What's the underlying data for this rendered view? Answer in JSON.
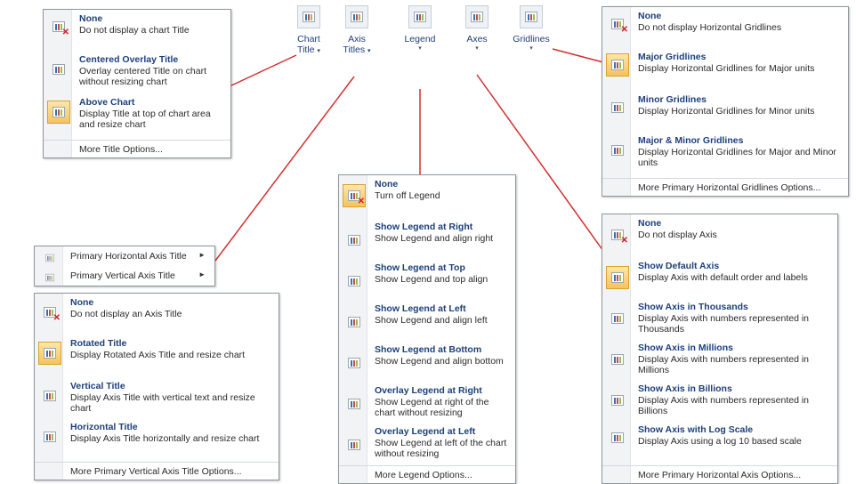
{
  "ribbon": {
    "chart_title": {
      "line1": "Chart",
      "line2": "Title"
    },
    "axis_titles": {
      "line1": "Axis",
      "line2": "Titles"
    },
    "legend": "Legend",
    "axes": "Axes",
    "gridlines": "Gridlines",
    "dropdown": "▾"
  },
  "chart_title_menu": {
    "items": [
      {
        "title": "None",
        "desc": "Do not display a chart Title"
      },
      {
        "title": "Centered Overlay Title",
        "desc": "Overlay centered Title on chart without resizing chart"
      },
      {
        "title": "Above Chart",
        "desc": "Display Title at top of chart area and resize chart"
      }
    ],
    "more": "More Title Options..."
  },
  "gridlines_menu": {
    "items": [
      {
        "title": "None",
        "desc": "Do not display Horizontal Gridlines"
      },
      {
        "title": "Major Gridlines",
        "desc": "Display Horizontal Gridlines for Major units"
      },
      {
        "title": "Minor Gridlines",
        "desc": "Display Horizontal Gridlines for Minor units"
      },
      {
        "title": "Major & Minor Gridlines",
        "desc": "Display Horizontal Gridlines for Major and Minor units"
      }
    ],
    "more": "More Primary Horizontal Gridlines Options..."
  },
  "axis_titles_submenu": {
    "items": [
      "Primary Horizontal Axis Title",
      "Primary Vertical Axis Title"
    ]
  },
  "vertical_axis_title_menu": {
    "items": [
      {
        "title": "None",
        "desc": "Do not display an Axis Title"
      },
      {
        "title": "Rotated Title",
        "desc": "Display Rotated Axis Title and resize chart"
      },
      {
        "title": "Vertical Title",
        "desc": "Display Axis Title with vertical text and resize chart"
      },
      {
        "title": "Horizontal Title",
        "desc": "Display Axis Title horizontally and resize chart"
      }
    ],
    "more": "More Primary Vertical Axis Title Options..."
  },
  "legend_menu": {
    "items": [
      {
        "title": "None",
        "desc": "Turn off Legend"
      },
      {
        "title": "Show Legend at Right",
        "desc": "Show Legend and align right"
      },
      {
        "title": "Show Legend at Top",
        "desc": "Show Legend and top align"
      },
      {
        "title": "Show Legend at Left",
        "desc": "Show Legend and align left"
      },
      {
        "title": "Show Legend at Bottom",
        "desc": "Show Legend and align bottom"
      },
      {
        "title": "Overlay Legend at Right",
        "desc": "Show Legend at right of the chart without resizing"
      },
      {
        "title": "Overlay Legend at Left",
        "desc": "Show Legend at left of the chart without resizing"
      }
    ],
    "more": "More Legend Options..."
  },
  "axes_menu": {
    "items": [
      {
        "title": "None",
        "desc": "Do not display Axis"
      },
      {
        "title": "Show Default Axis",
        "desc": "Display Axis with default order and labels"
      },
      {
        "title": "Show Axis in Thousands",
        "desc": "Display Axis with numbers represented in Thousands"
      },
      {
        "title": "Show Axis in Millions",
        "desc": "Display Axis with numbers represented in Millions"
      },
      {
        "title": "Show Axis in Billions",
        "desc": "Display Axis with numbers represented in Billions"
      },
      {
        "title": "Show Axis with Log Scale",
        "desc": "Display Axis using a log 10 based scale"
      }
    ],
    "more": "More Primary Horizontal Axis Options..."
  },
  "colors": {
    "connector": "#d32f2f",
    "selected_fill": "#f6c35d",
    "title_text": "#1d3f7a"
  }
}
